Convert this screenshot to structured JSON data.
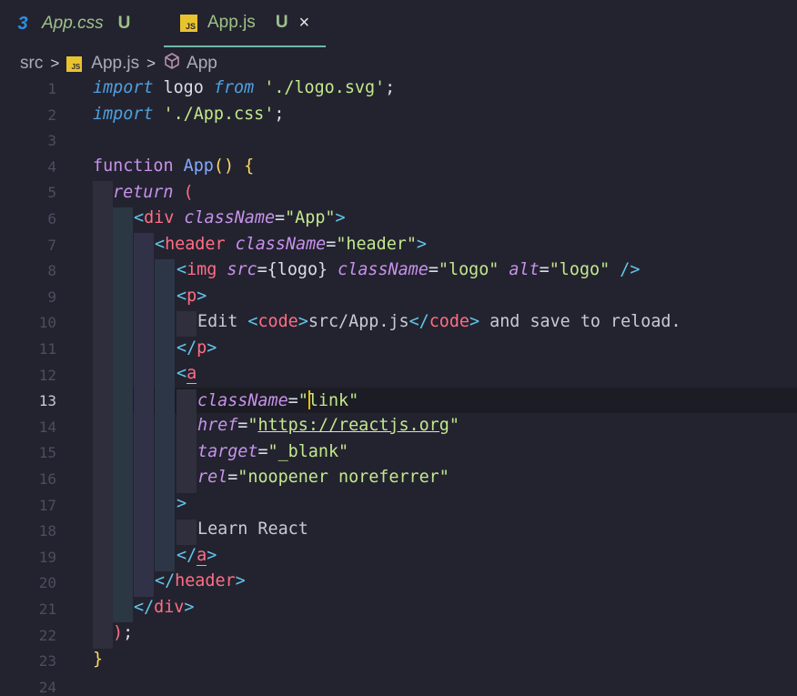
{
  "tabs": [
    {
      "icon": "css-file-icon",
      "label": "App.css",
      "status": "U",
      "active": false
    },
    {
      "icon": "js-file-icon",
      "label": "App.js",
      "status": "U",
      "active": true,
      "close": "×"
    }
  ],
  "breadcrumb": {
    "folder": "src",
    "file": "App.js",
    "symbol": "App",
    "file_icon_text": "JS"
  },
  "css_icon_glyph": "3",
  "active_line": 13,
  "lines": [
    {
      "n": "1"
    },
    {
      "n": "2"
    },
    {
      "n": "3"
    },
    {
      "n": "4"
    },
    {
      "n": "5"
    },
    {
      "n": "6"
    },
    {
      "n": "7"
    },
    {
      "n": "8"
    },
    {
      "n": "9"
    },
    {
      "n": "10"
    },
    {
      "n": "11"
    },
    {
      "n": "12"
    },
    {
      "n": "13"
    },
    {
      "n": "14"
    },
    {
      "n": "15"
    },
    {
      "n": "16"
    },
    {
      "n": "17"
    },
    {
      "n": "18"
    },
    {
      "n": "19"
    },
    {
      "n": "20"
    },
    {
      "n": "21"
    },
    {
      "n": "22"
    },
    {
      "n": "23"
    },
    {
      "n": "24"
    }
  ],
  "code": {
    "l1": {
      "import": "import",
      "ident": " logo ",
      "from": "from",
      "str": " './logo.svg'",
      "semi": ";"
    },
    "l2": {
      "import": "import",
      "str": " './App.css'",
      "semi": ";"
    },
    "l4": {
      "function": "function",
      "name": " App",
      "parens": "()",
      "brace": " {"
    },
    "l5": {
      "return": "return",
      "paren": " ("
    },
    "l6": {
      "open": "<",
      "tag": "div",
      "attr": " className",
      "eq": "=",
      "val": "\"App\"",
      "close": ">"
    },
    "l7": {
      "open": "<",
      "tag": "header",
      "attr": " className",
      "eq": "=",
      "val": "\"header\"",
      "close": ">"
    },
    "l8": {
      "open": "<",
      "tag": "img",
      "attr1": " src",
      "eq1": "=",
      "expr": "{logo}",
      "attr2": " className",
      "eq2": "=",
      "val2": "\"logo\"",
      "attr3": " alt",
      "eq3": "=",
      "val3": "\"logo\"",
      "close": " />"
    },
    "l9": {
      "open": "<",
      "tag": "p",
      "close": ">"
    },
    "l10": {
      "text1": "Edit ",
      "o1": "<",
      "tag1": "code",
      "c1": ">",
      "text2": "src/App.js",
      "o2": "</",
      "tag2": "code",
      "c2": ">",
      "text3": " and save to reload."
    },
    "l11": {
      "open": "</",
      "tag": "p",
      "close": ">"
    },
    "l12": {
      "open": "<",
      "tag": "a"
    },
    "l13": {
      "attr": "className",
      "eq": "=",
      "q": "\"",
      "val": "link\""
    },
    "l14": {
      "attr": "href",
      "eq": "=",
      "q": "\"",
      "val": "https://reactjs.org",
      "q2": "\""
    },
    "l15": {
      "attr": "target",
      "eq": "=",
      "val": "\"_blank\""
    },
    "l16": {
      "attr": "rel",
      "eq": "=",
      "val": "\"noopener noreferrer\""
    },
    "l17": {
      "close": ">"
    },
    "l18": {
      "text": "Learn React"
    },
    "l19": {
      "open": "</",
      "tag": "a",
      "close": ">"
    },
    "l20": {
      "open": "</",
      "tag": "header",
      "close": ">"
    },
    "l21": {
      "open": "</",
      "tag": "div",
      "close": ">"
    },
    "l22": {
      "paren": ")",
      "semi": ";"
    },
    "l23": {
      "brace": "}"
    }
  }
}
